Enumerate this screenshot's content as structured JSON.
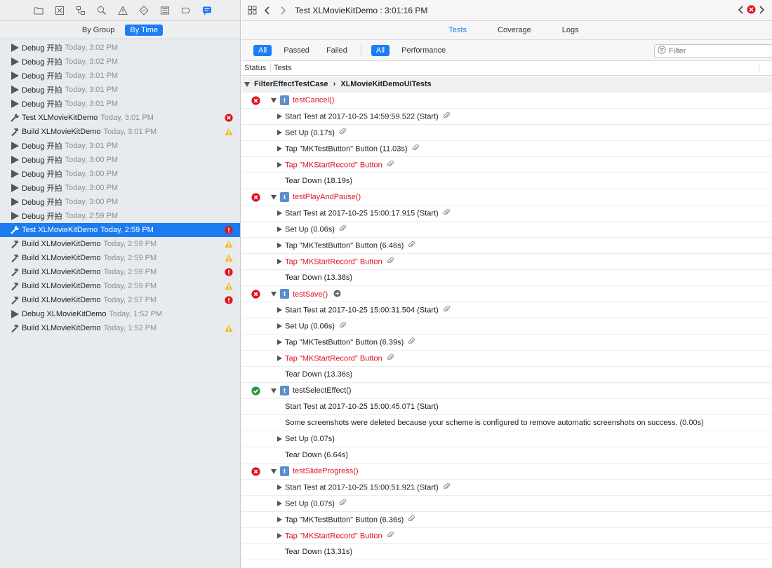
{
  "navigator": {
    "toolbar_icons": [
      "folder-icon",
      "source-control-icon",
      "symbol-icon",
      "find-icon",
      "issue-icon",
      "test-icon",
      "debug-icon",
      "breakpoint-icon",
      "report-icon"
    ],
    "group_by": [
      "By Group",
      "By Time"
    ],
    "logs": [
      {
        "kind": "debug",
        "name": "Debug 开拍",
        "time": "Today, 3:02 PM",
        "status": ""
      },
      {
        "kind": "debug",
        "name": "Debug 开拍",
        "time": "Today, 3:02 PM",
        "status": ""
      },
      {
        "kind": "debug",
        "name": "Debug 开拍",
        "time": "Today, 3:01 PM",
        "status": ""
      },
      {
        "kind": "debug",
        "name": "Debug 开拍",
        "time": "Today, 3:01 PM",
        "status": ""
      },
      {
        "kind": "debug",
        "name": "Debug 开拍",
        "time": "Today, 3:01 PM",
        "status": ""
      },
      {
        "kind": "test",
        "name": "Test XLMovieKitDemo",
        "time": "Today, 3:01 PM",
        "status": "fail"
      },
      {
        "kind": "build",
        "name": "Build XLMovieKitDemo",
        "time": "Today, 3:01 PM",
        "status": "warning"
      },
      {
        "kind": "debug",
        "name": "Debug 开拍",
        "time": "Today, 3:01 PM",
        "status": ""
      },
      {
        "kind": "debug",
        "name": "Debug 开拍",
        "time": "Today, 3:00 PM",
        "status": ""
      },
      {
        "kind": "debug",
        "name": "Debug 开拍",
        "time": "Today, 3:00 PM",
        "status": ""
      },
      {
        "kind": "debug",
        "name": "Debug 开拍",
        "time": "Today, 3:00 PM",
        "status": ""
      },
      {
        "kind": "debug",
        "name": "Debug 开拍",
        "time": "Today, 3:00 PM",
        "status": ""
      },
      {
        "kind": "debug",
        "name": "Debug 开拍",
        "time": "Today, 2:59 PM",
        "status": ""
      },
      {
        "kind": "test",
        "name": "Test XLMovieKitDemo",
        "time": "Today, 2:59 PM",
        "status": "error",
        "selected": true
      },
      {
        "kind": "build",
        "name": "Build XLMovieKitDemo",
        "time": "Today, 2:59 PM",
        "status": "warning"
      },
      {
        "kind": "build",
        "name": "Build XLMovieKitDemo",
        "time": "Today, 2:59 PM",
        "status": "warning"
      },
      {
        "kind": "build",
        "name": "Build XLMovieKitDemo",
        "time": "Today, 2:59 PM",
        "status": "error"
      },
      {
        "kind": "build",
        "name": "Build XLMovieKitDemo",
        "time": "Today, 2:59 PM",
        "status": "warning"
      },
      {
        "kind": "build",
        "name": "Build XLMovieKitDemo",
        "time": "Today, 2:57 PM",
        "status": "error"
      },
      {
        "kind": "debug",
        "name": "Debug XLMovieKitDemo",
        "time": "Today, 1:52 PM",
        "status": ""
      },
      {
        "kind": "build",
        "name": "Build XLMovieKitDemo",
        "time": "Today, 1:52 PM",
        "status": "warning"
      }
    ]
  },
  "editor": {
    "title": "Test XLMovieKitDemo : 3:01:16 PM",
    "view_tabs": [
      "Tests",
      "Coverage",
      "Logs"
    ],
    "filters": [
      "All",
      "Passed",
      "Failed"
    ],
    "scope": [
      "All",
      "Performance"
    ],
    "filter_placeholder": "Filter",
    "columns": {
      "status": "Status",
      "tests": "Tests"
    },
    "suite": {
      "class": "FilterEffectTestCase",
      "target": "XLMovieKitDemoUITests"
    },
    "cases": [
      {
        "name": "testCancel()",
        "status": "fail",
        "actions": [
          {
            "text": "Start Test at 2017-10-25 14:59:59.522 (Start)",
            "expandable": true,
            "clip": true,
            "fail": false
          },
          {
            "text": "Set Up (0.17s)",
            "expandable": true,
            "clip": true,
            "fail": false
          },
          {
            "text": "Tap \"MKTestButton\" Button (11.03s)",
            "expandable": true,
            "clip": true,
            "fail": false
          },
          {
            "text": "Tap \"MKStartRecord\" Button",
            "expandable": true,
            "clip": true,
            "fail": true
          },
          {
            "text": "Tear Down (18.19s)",
            "expandable": false,
            "clip": false,
            "fail": false
          }
        ]
      },
      {
        "name": "testPlayAndPause()",
        "status": "fail",
        "actions": [
          {
            "text": "Start Test at 2017-10-25 15:00:17.915 (Start)",
            "expandable": true,
            "clip": true,
            "fail": false
          },
          {
            "text": "Set Up (0.06s)",
            "expandable": true,
            "clip": true,
            "fail": false
          },
          {
            "text": "Tap \"MKTestButton\" Button (6.46s)",
            "expandable": true,
            "clip": true,
            "fail": false
          },
          {
            "text": "Tap \"MKStartRecord\" Button",
            "expandable": true,
            "clip": true,
            "fail": true
          },
          {
            "text": "Tear Down (13.38s)",
            "expandable": false,
            "clip": false,
            "fail": false
          }
        ]
      },
      {
        "name": "testSave()",
        "status": "fail",
        "arrow": true,
        "actions": [
          {
            "text": "Start Test at 2017-10-25 15:00:31.504 (Start)",
            "expandable": true,
            "clip": true,
            "fail": false
          },
          {
            "text": "Set Up (0.06s)",
            "expandable": true,
            "clip": true,
            "fail": false
          },
          {
            "text": "Tap \"MKTestButton\" Button (6.39s)",
            "expandable": true,
            "clip": true,
            "fail": false
          },
          {
            "text": "Tap \"MKStartRecord\" Button",
            "expandable": true,
            "clip": true,
            "fail": true
          },
          {
            "text": "Tear Down (13.36s)",
            "expandable": false,
            "clip": false,
            "fail": false
          }
        ]
      },
      {
        "name": "testSelectEffect()",
        "status": "pass",
        "actions": [
          {
            "text": "Start Test at 2017-10-25 15:00:45.071 (Start)",
            "expandable": false,
            "clip": false,
            "fail": false
          },
          {
            "text": "Some screenshots were deleted because your scheme is configured to remove automatic screenshots on success. (0.00s)",
            "expandable": false,
            "clip": false,
            "fail": false
          },
          {
            "text": "Set Up (0.07s)",
            "expandable": true,
            "clip": false,
            "fail": false
          },
          {
            "text": "Tear Down (6.64s)",
            "expandable": false,
            "clip": false,
            "fail": false
          }
        ]
      },
      {
        "name": "testSlideProgress()",
        "status": "fail",
        "actions": [
          {
            "text": "Start Test at 2017-10-25 15:00:51.921 (Start)",
            "expandable": true,
            "clip": true,
            "fail": false
          },
          {
            "text": "Set Up (0.07s)",
            "expandable": true,
            "clip": true,
            "fail": false
          },
          {
            "text": "Tap \"MKTestButton\" Button (6.36s)",
            "expandable": true,
            "clip": true,
            "fail": false
          },
          {
            "text": "Tap \"MKStartRecord\" Button",
            "expandable": true,
            "clip": true,
            "fail": true
          },
          {
            "text": "Tear Down (13.31s)",
            "expandable": false,
            "clip": false,
            "fail": false
          }
        ]
      }
    ]
  },
  "colors": {
    "accent": "#1b7cf5",
    "fail": "#e0131e",
    "warning": "#f5b821",
    "pass": "#1e9a3a"
  }
}
